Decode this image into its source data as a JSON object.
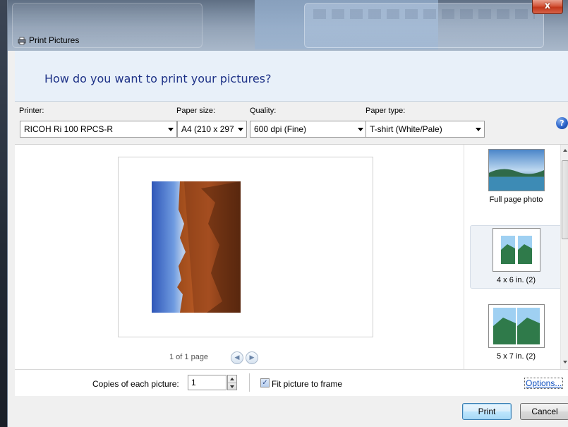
{
  "window": {
    "title": "Print Pictures",
    "close_glyph": "x"
  },
  "header": {
    "question": "How do you want to print your pictures?"
  },
  "options": {
    "printer_label": "Printer:",
    "printer_value": "RICOH Ri 100 RPCS-R",
    "paper_size_label": "Paper size:",
    "paper_size_value": "A4 (210 x 297",
    "quality_label": "Quality:",
    "quality_value": "600 dpi (Fine)",
    "paper_type_label": "Paper type:",
    "paper_type_value": "T-shirt (White/Pale)",
    "help_glyph": "?"
  },
  "preview": {
    "page_count": "1 of 1 page",
    "prev_glyph": "◀",
    "next_glyph": "▶"
  },
  "layouts": [
    {
      "label": "Full page photo",
      "selected": false
    },
    {
      "label": "4 x 6 in. (2)",
      "selected": true
    },
    {
      "label": "5 x 7 in. (2)",
      "selected": false
    }
  ],
  "bottom": {
    "copies_label": "Copies of each picture:",
    "copies_value": "1",
    "fit_label": "Fit picture to frame",
    "fit_checked": true,
    "check_glyph": "✓",
    "options_link": "Options..."
  },
  "footer": {
    "print_label": "Print",
    "cancel_label": "Cancel"
  },
  "colors": {
    "header_text": "#1e3287",
    "header_bg": "#e8f0f9",
    "link": "#0f4fbf",
    "close_red": "#c2361a"
  }
}
